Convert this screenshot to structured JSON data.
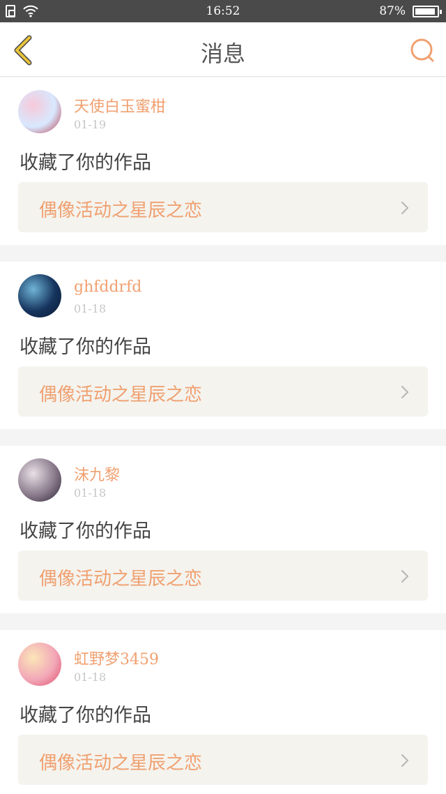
{
  "status_bar": {
    "time": "16:52",
    "battery_percent": "87%"
  },
  "header": {
    "title": "消息"
  },
  "colors": {
    "accent": "#f0a070",
    "back_icon": "#e8c33a",
    "card_action": "#f4f3ee"
  },
  "messages": [
    {
      "username": "天使白玉蜜柑",
      "date": "01-19",
      "action": "收藏了你的作品",
      "work_title": "偶像活动之星辰之恋",
      "avatar_palette": [
        "#f7c9d9",
        "#d8e8ff",
        "#b83a4a"
      ]
    },
    {
      "username": "ghfddrfd",
      "date": "01-18",
      "action": "收藏了你的作品",
      "work_title": "偶像活动之星辰之恋",
      "avatar_palette": [
        "#6fb4d6",
        "#16345e",
        "#0b1a33"
      ]
    },
    {
      "username": "沫九黎",
      "date": "01-18",
      "action": "收藏了你的作品",
      "work_title": "偶像活动之星辰之恋",
      "avatar_palette": [
        "#e8e1e6",
        "#8a7a8c",
        "#2a2430"
      ]
    },
    {
      "username": "虹野梦3459",
      "date": "01-18",
      "action": "收藏了你的作品",
      "work_title": "偶像活动之星辰之恋",
      "avatar_palette": [
        "#fbe6b8",
        "#f2a8b8",
        "#e04a6a"
      ]
    }
  ]
}
